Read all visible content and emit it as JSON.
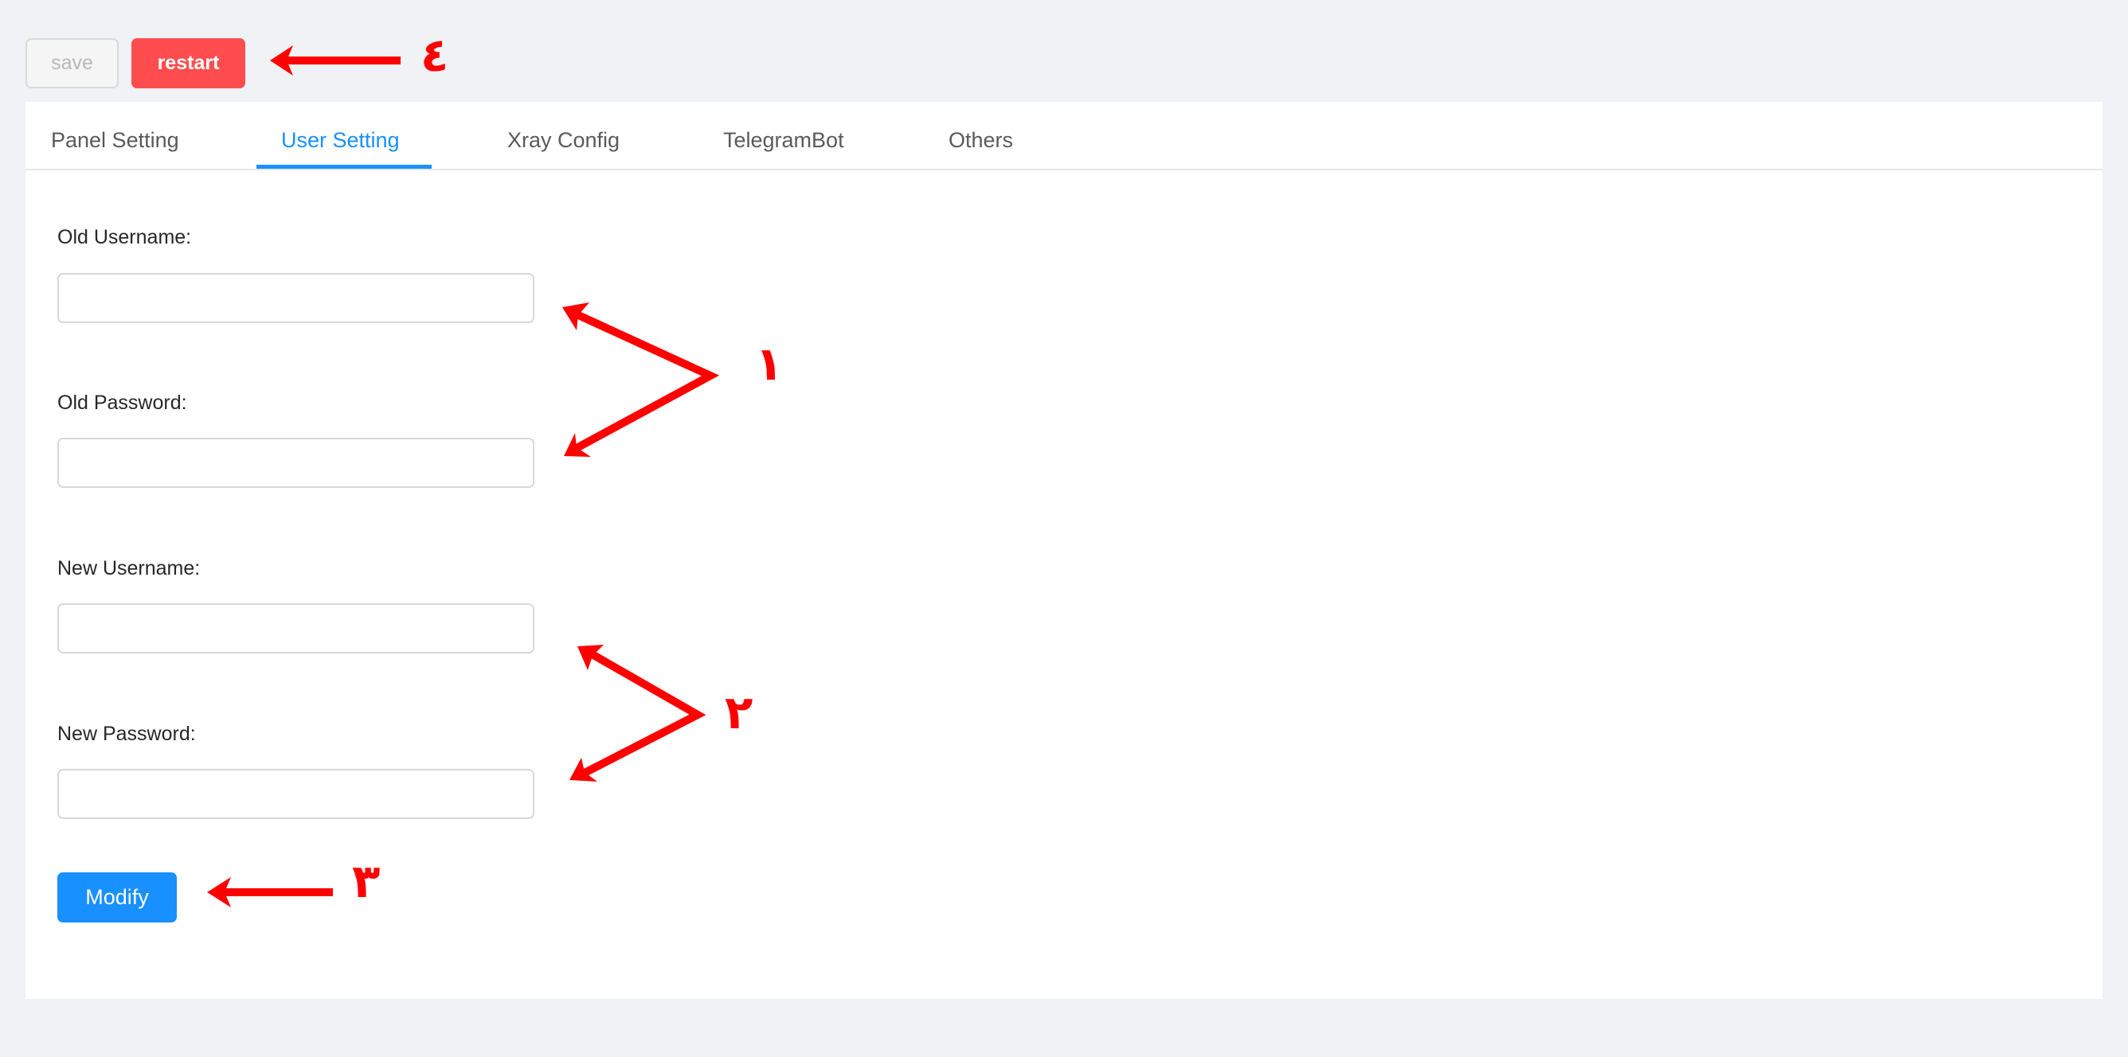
{
  "toolbar": {
    "save_label": "save",
    "restart_label": "restart"
  },
  "tabs": [
    {
      "label": "Panel Setting",
      "active": false
    },
    {
      "label": "User Setting",
      "active": true
    },
    {
      "label": "Xray Config",
      "active": false
    },
    {
      "label": "TelegramBot",
      "active": false
    },
    {
      "label": "Others",
      "active": false
    }
  ],
  "form": {
    "old_username": {
      "label": "Old Username:",
      "value": "",
      "placeholder": ""
    },
    "old_password": {
      "label": "Old Password:",
      "value": "",
      "placeholder": ""
    },
    "new_username": {
      "label": "New Username:",
      "value": "",
      "placeholder": ""
    },
    "new_password": {
      "label": "New Password:",
      "value": "",
      "placeholder": ""
    },
    "modify_label": "Modify"
  },
  "annotations": {
    "numeral_1": "١",
    "numeral_2": "٢",
    "numeral_3": "٣",
    "numeral_4": "٤"
  },
  "colors": {
    "primary": "#1890ff",
    "danger": "#ff4d4f",
    "annotation": "#ff0000",
    "background": "#f0f2f5"
  }
}
